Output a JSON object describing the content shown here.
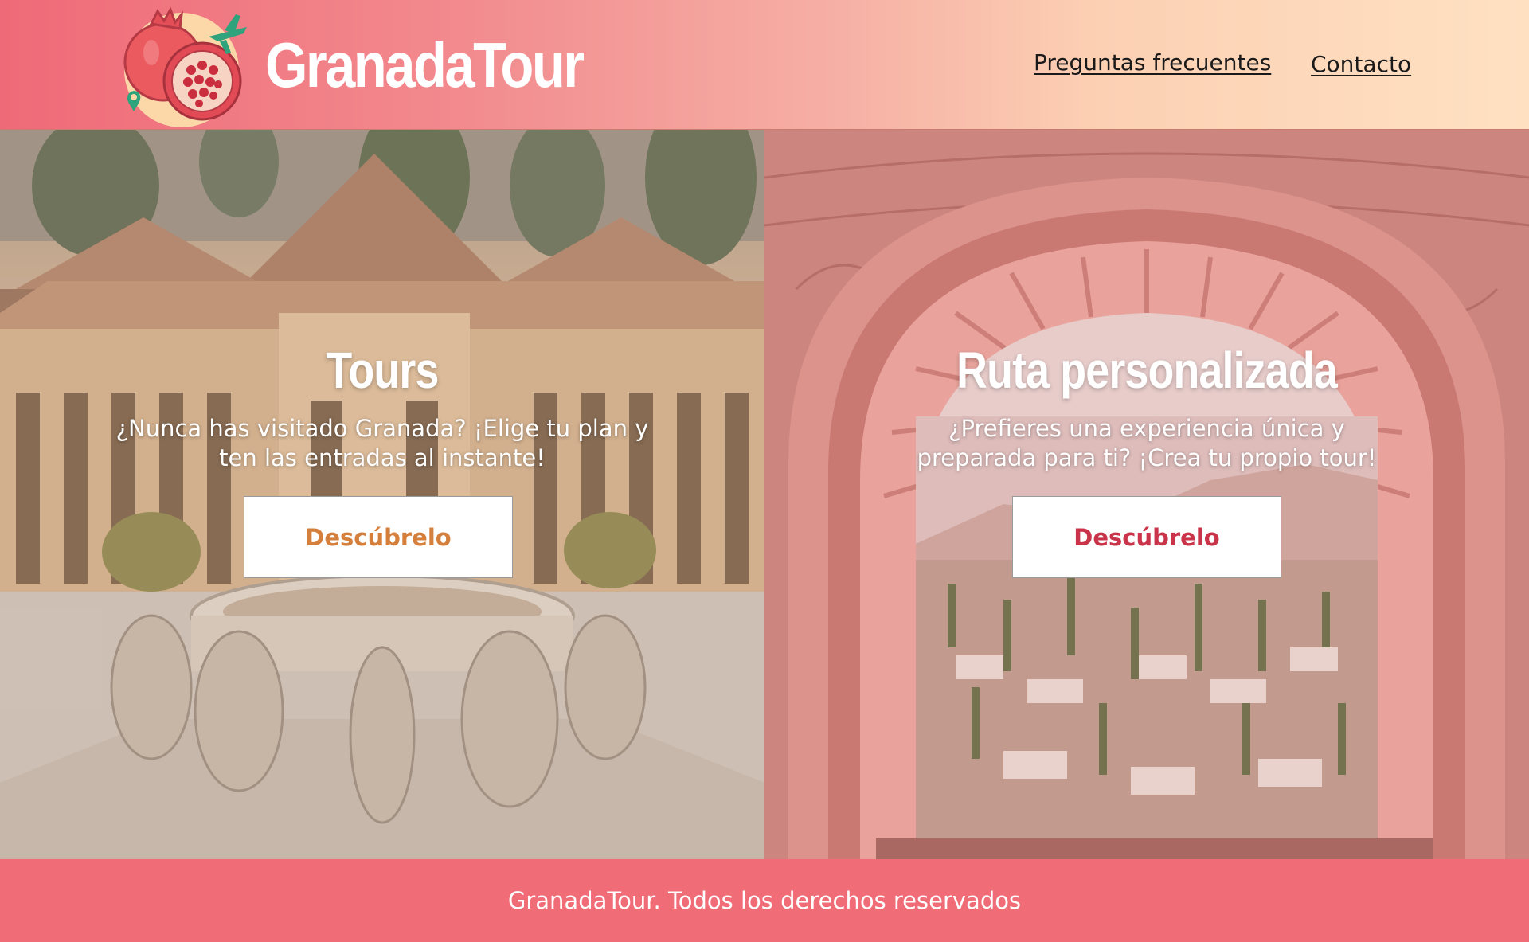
{
  "header": {
    "brand": "GranadaTour",
    "logo_icon": "pomegranate-plane-logo",
    "nav": [
      {
        "label": "Preguntas frecuentes"
      },
      {
        "label": "Contacto"
      }
    ]
  },
  "panels": {
    "tours": {
      "title": "Tours",
      "description": "¿Nunca has visitado Granada? ¡Elige tu plan y ten las entradas al instante!",
      "button": "Descúbrelo",
      "button_color": "#d57f3c",
      "background": "alhambra-court-of-lions-photo"
    },
    "custom_route": {
      "title": "Ruta personalizada",
      "description": "¿Prefieres una experiencia única y preparada para ti? ¡Crea tu propio tour!",
      "button": "Descúbrelo",
      "button_color": "#c9344a",
      "background": "albaicin-through-arch-photo"
    }
  },
  "footer": {
    "text": "GranadaTour. Todos los derechos reservados"
  },
  "colors": {
    "brand_coral": "#f06c77",
    "header_peach": "#ffe1c2"
  }
}
